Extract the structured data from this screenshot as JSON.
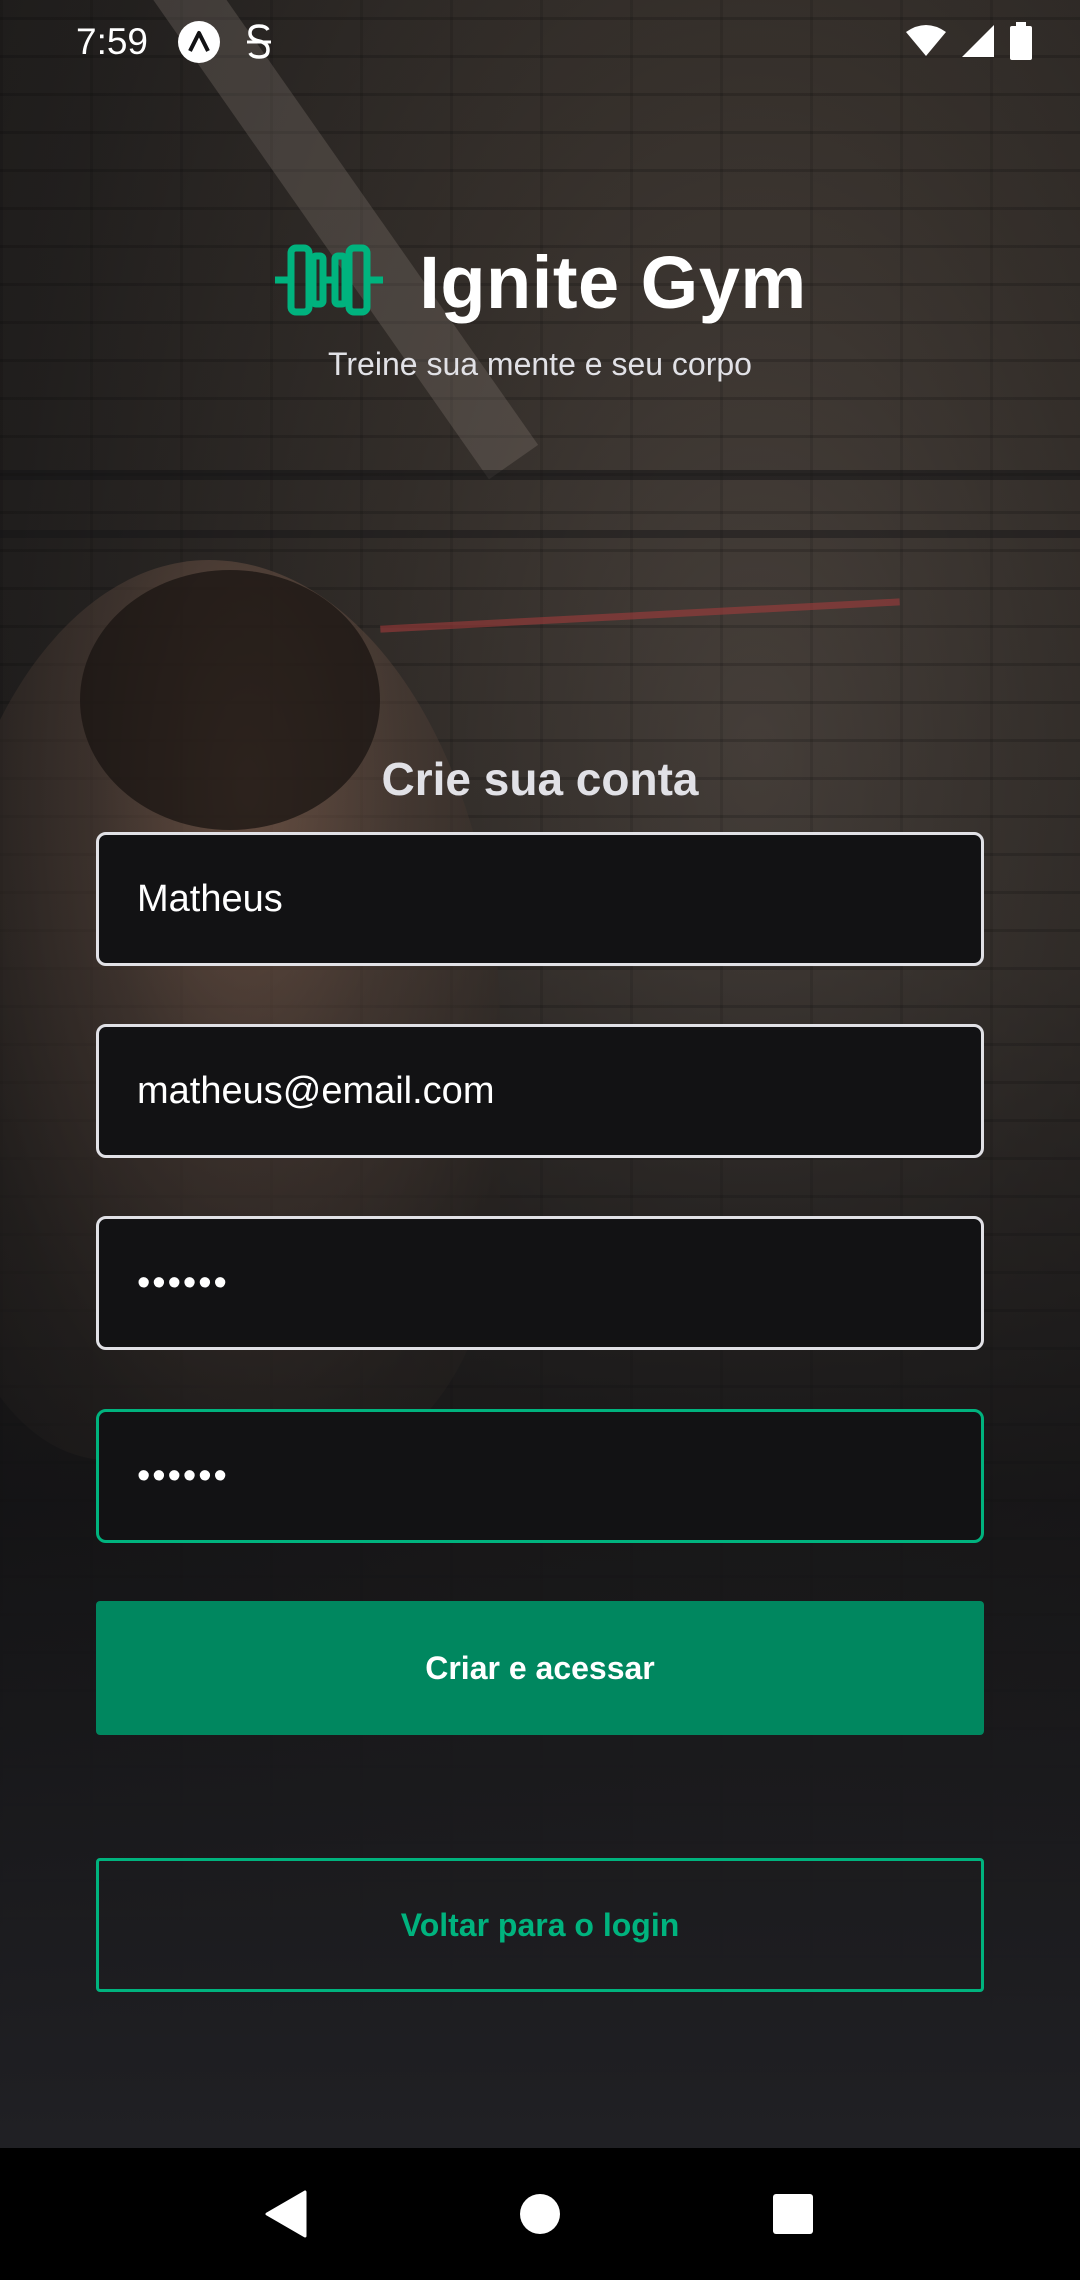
{
  "status_bar": {
    "time": "7:59",
    "notif_icons": [
      "app-a-icon",
      "s-icon"
    ],
    "right_icons": [
      "wifi-icon",
      "signal-icon",
      "battery-icon"
    ]
  },
  "header": {
    "logo_icon": "dumbbell-icon",
    "title": "Ignite Gym",
    "tagline": "Treine sua mente e seu corpo"
  },
  "form": {
    "title": "Crie sua conta",
    "name_value": "Matheus",
    "email_value": "matheus@email.com",
    "password_value": "••••••",
    "confirm_password_value": "••••••",
    "submit_label": "Criar e acessar",
    "back_label": "Voltar para o login"
  },
  "nav": {
    "icons": [
      "back-icon",
      "home-icon",
      "recents-icon"
    ]
  },
  "colors": {
    "accent": "#00b37e",
    "button": "#00875f",
    "background": "#121214"
  }
}
